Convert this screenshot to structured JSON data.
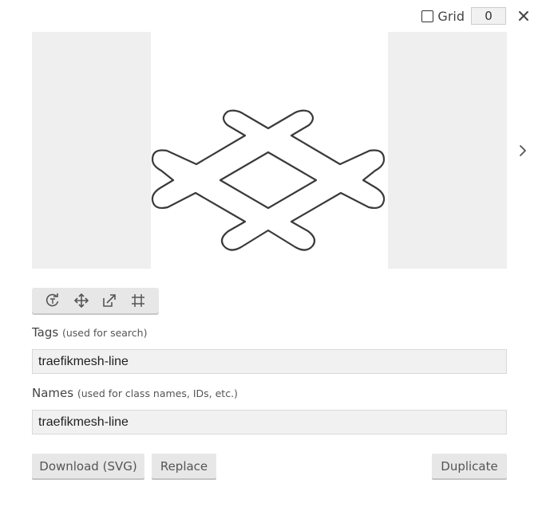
{
  "header": {
    "grid_label": "Grid",
    "grid_value": "0",
    "grid_checked": false
  },
  "preview": {
    "icon_name": "traefikmesh-line"
  },
  "toolbar": {
    "tools": [
      "rotate-icon",
      "move-icon",
      "resize-icon",
      "crop-grid-icon"
    ]
  },
  "tags": {
    "label": "Tags",
    "hint": "(used for search)",
    "value": "traefikmesh-line"
  },
  "names": {
    "label": "Names",
    "hint": "(used for class names, IDs, etc.)",
    "value": "traefikmesh-line"
  },
  "actions": {
    "download_label": "Download (SVG)",
    "replace_label": "Replace",
    "duplicate_label": "Duplicate"
  },
  "colors": {
    "panel_bg": "#efefef",
    "button_bg": "#e7e7e7",
    "stroke": "#333333"
  }
}
